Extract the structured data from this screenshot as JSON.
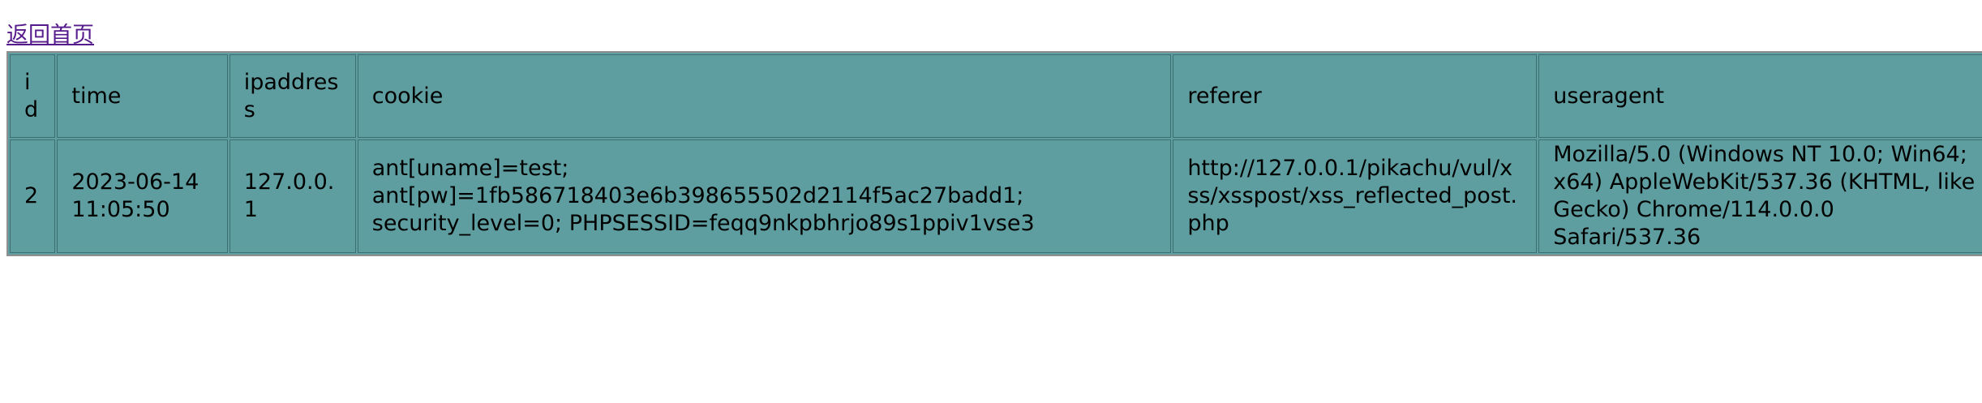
{
  "nav": {
    "back_home": "返回首页"
  },
  "table": {
    "headers": {
      "id": "id",
      "time": "time",
      "ipaddress": "ipaddress",
      "cookie": "cookie",
      "referer": "referer",
      "useragent": "useragent"
    },
    "rows": [
      {
        "id": "2",
        "time": "2023-06-14 11:05:50",
        "ipaddress": "127.0.0.1",
        "cookie": "ant[uname]=test; ant[pw]=1fb586718403e6b398655502d2114f5ac27badd1; security_level=0; PHPSESSID=feqq9nkpbhrjo89s1ppiv1vse3",
        "referer": "http://127.0.0.1/pikachu/vul/xss/xsspost/xss_reflected_post.php",
        "useragent": "Mozilla/5.0 (Windows NT 10.0; Win64; x64) AppleWebKit/537.36 (KHTML, like Gecko) Chrome/114.0.0.0 Safari/537.36"
      }
    ]
  },
  "colors": {
    "table_bg": "#5f9ea0",
    "link": "#551a8b"
  }
}
